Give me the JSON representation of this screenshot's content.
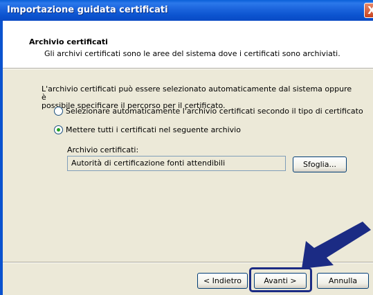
{
  "window": {
    "title": "Importazione guidata certificati",
    "close_label": "X"
  },
  "header": {
    "title": "Archivio certificati",
    "subtitle": "Gli archivi certificati sono le aree del sistema dove i certificati sono archiviati."
  },
  "body": {
    "intro_line1": "L'archivio certificati può essere selezionato automaticamente dal sistema oppure è",
    "intro_line2": "possibile specificare il percorso per il certificato.",
    "radio_auto_label": "Selezionare automaticamente l'archivio certificati secondo il tipo di certificato",
    "radio_manual_label": "Mettere tutti i certificati nel seguente archivio",
    "selected_option": "manual",
    "store_label": "Archivio certificati:",
    "store_value": "Autorità di certificazione fonti attendibili",
    "browse_label": "Sfoglia..."
  },
  "footer": {
    "back_label": "< Indietro",
    "next_label": "Avanti >",
    "cancel_label": "Annulla"
  },
  "colors": {
    "titlebar": "#0b53cf",
    "dialog_background": "#ece9d8",
    "annotation_arrow": "#1b2b84"
  }
}
